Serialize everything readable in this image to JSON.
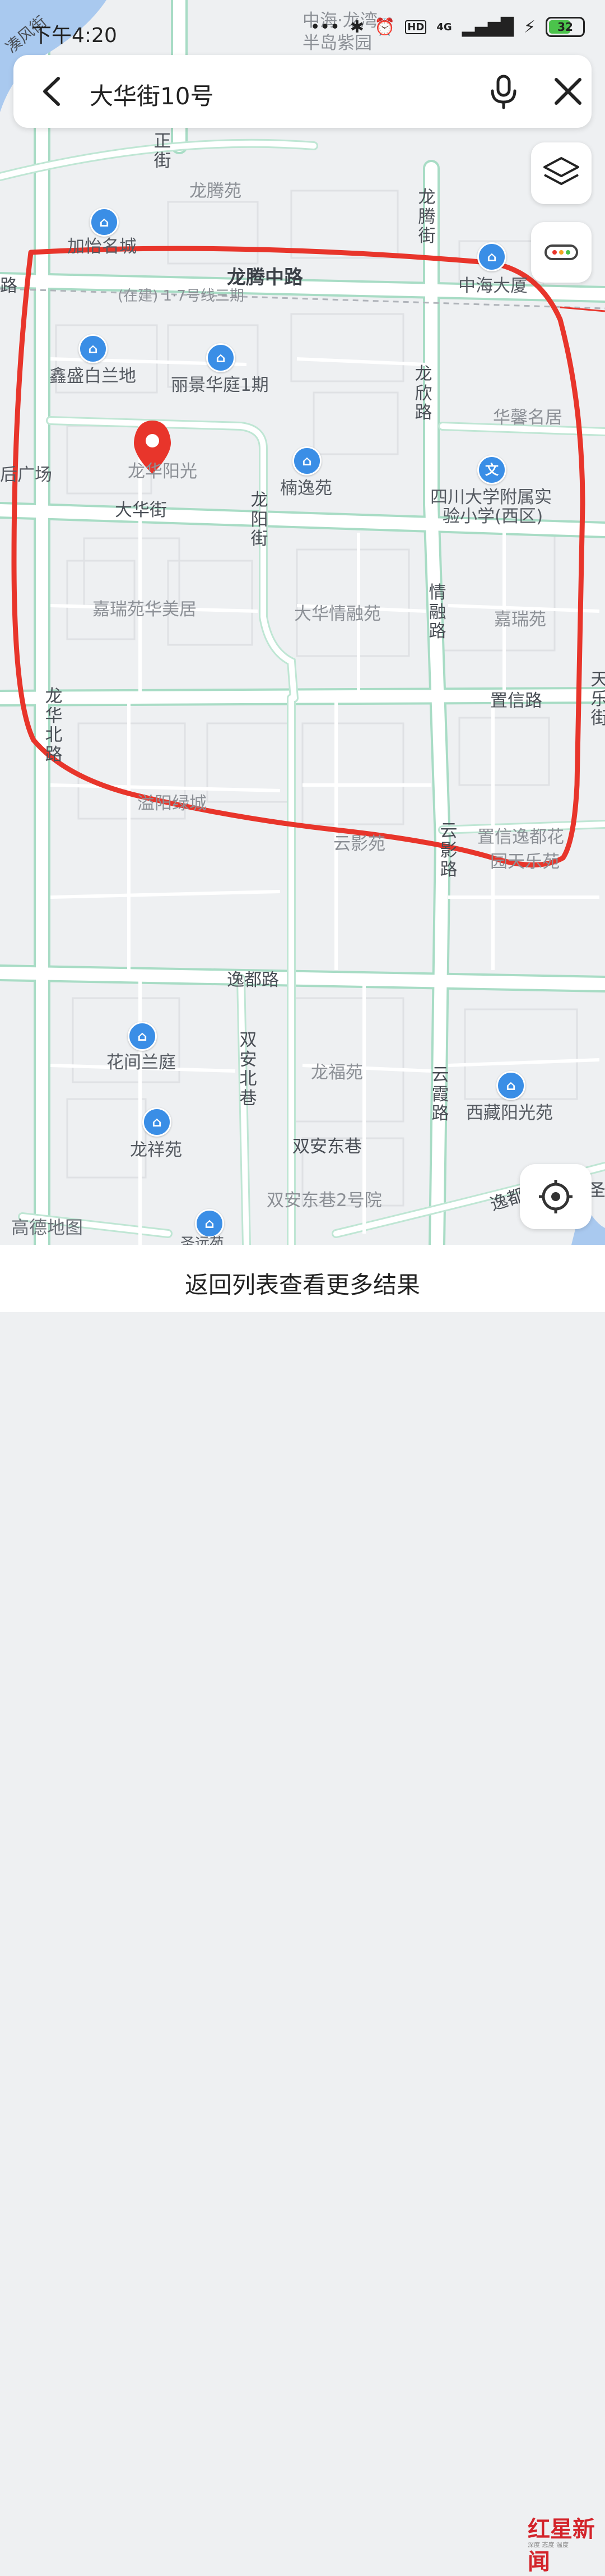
{
  "status_bar": {
    "time": "下午4:20",
    "network": "4G",
    "hd": "HD",
    "battery": "32"
  },
  "search": {
    "query": "大华街10号"
  },
  "map": {
    "roads": {
      "longteng_middle": "龙腾中路",
      "metro_note": "(在建) 1·7号线三期",
      "longxin": "龙欣路",
      "longteng_street": "龙腾街",
      "dahua": "大华街",
      "longyang": "龙阳街",
      "qingrong": "情融路",
      "longhua_north": "龙华北路",
      "zhixin": "置信路",
      "yunying": "云影路",
      "yidu": "逸都路",
      "shuangan_north": "双安北巷",
      "shuangan_east": "双安东巷",
      "yunxia": "云霞路",
      "tianle": "天乐街",
      "zheng": "正街",
      "yuanfeng": "凑风街",
      "lu_left": "路",
      "yidu_right": "逸都",
      "sheng": "圣"
    },
    "places": {
      "zhonghai": "中海·龙湾",
      "zhonghai2": "半岛紫园",
      "longteng_yuan": "龙腾苑",
      "jiayi": "加怡名城",
      "zhonghai_tower": "中海大厦",
      "xinsheng": "鑫盛白兰地",
      "lijing": "丽景华庭1期",
      "huaxin": "华馨名居",
      "longhua_yangguang": "龙华阳光",
      "nanyi": "楠逸苑",
      "school1": "四川大学附属实",
      "school2": "验小学(西区)",
      "plaza": "后广场",
      "jiarui_huamei": "嘉瑞苑华美居",
      "dahua_qingrong": "大华情融苑",
      "jiarui": "嘉瑞苑",
      "yiyang": "溢阳绿城",
      "yunying_yuan": "云影苑",
      "zhixin_yidu": "置信逸都花",
      "xitian": "园天乐苑",
      "huajian": "花间兰庭",
      "longfu": "龙福苑",
      "xizang": "西藏阳光苑",
      "longxiang": "龙祥苑",
      "shuangan2": "双安东巷2号院",
      "shengyuan": "圣远苑"
    },
    "brand": "高德地图"
  },
  "bottom": {
    "label": "返回列表查看更多结果"
  },
  "watermark": {
    "brand": "红星新闻",
    "tagline": "深度 态度 温度"
  },
  "colors": {
    "road_fill": "#ffffff",
    "road_edge": "#a8dcc5",
    "highlight": "#e8352b",
    "pin": "#e8352b",
    "poi": "#3a8ee6"
  }
}
